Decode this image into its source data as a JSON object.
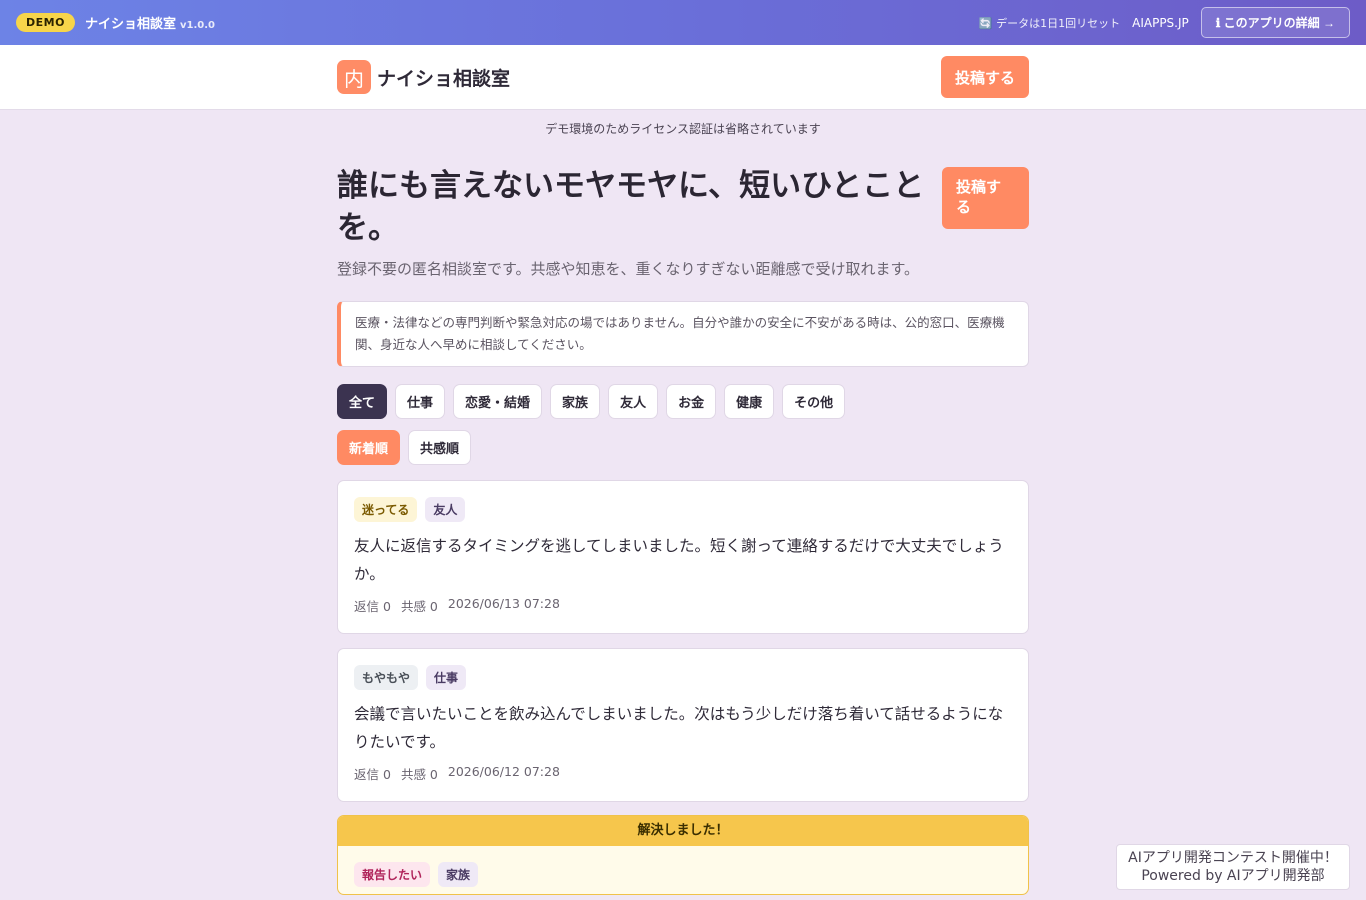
{
  "demobar": {
    "badge": "DEMO",
    "app_name": "ナイショ相談室",
    "version": "v1.0.0",
    "reset_note": "🔄 データは1日1回リセット",
    "site_link": "AIAPPS.JP",
    "detail_button": "ℹ このアプリの詳細 →"
  },
  "header": {
    "logo_char": "内",
    "brand_name": "ナイショ相談室",
    "post_button": "投稿する"
  },
  "license_note": "デモ環境のためライセンス認証は省略されています",
  "hero": {
    "title": "誰にも言えないモヤモヤに、短いひとことを。",
    "subtitle": "登録不要の匿名相談室です。共感や知恵を、重くなりすぎない距離感で受け取れます。",
    "post_button": "投稿する"
  },
  "notice": "医療・法律などの専門判断や緊急対応の場ではありません。自分や誰かの安全に不安がある時は、公的窓口、医療機関、身近な人へ早めに相談してください。",
  "filters": [
    "全て",
    "仕事",
    "恋愛・結婚",
    "家族",
    "友人",
    "お金",
    "健康",
    "その他"
  ],
  "sorts": [
    "新着順",
    "共感順"
  ],
  "posts": [
    {
      "mood": "迷ってる",
      "category": "友人",
      "body": "友人に返信するタイミングを逃してしまいました。短く謝って連絡するだけで大丈夫でしょうか。",
      "replies": "返信 0",
      "empathy": "共感 0",
      "date": "2026/06/13 07:28"
    },
    {
      "mood": "もやもや",
      "category": "仕事",
      "body": "会議で言いたいことを飲み込んでしまいました。次はもう少しだけ落ち着いて話せるようになりたいです。",
      "replies": "返信 0",
      "empathy": "共感 0",
      "date": "2026/06/12 07:28"
    }
  ],
  "resolved": {
    "label": "解決しました！",
    "mood": "報告したい",
    "category": "家族"
  },
  "contest": {
    "line1": "AIアプリ開発コンテスト開催中！",
    "line2": "Powered by AIアプリ開発部"
  }
}
